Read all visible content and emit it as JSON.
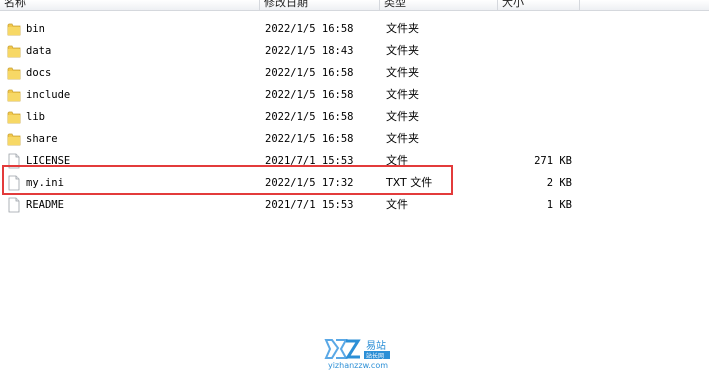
{
  "columns": {
    "name": "名称",
    "date": "修改日期",
    "type": "类型",
    "size": "大小"
  },
  "files": [
    {
      "name": "bin",
      "date": "2022/1/5 16:58",
      "type": "文件夹",
      "size": "",
      "icon": "folder-icon"
    },
    {
      "name": "data",
      "date": "2022/1/5 18:43",
      "type": "文件夹",
      "size": "",
      "icon": "folder-icon"
    },
    {
      "name": "docs",
      "date": "2022/1/5 16:58",
      "type": "文件夹",
      "size": "",
      "icon": "folder-icon"
    },
    {
      "name": "include",
      "date": "2022/1/5 16:58",
      "type": "文件夹",
      "size": "",
      "icon": "folder-icon"
    },
    {
      "name": "lib",
      "date": "2022/1/5 16:58",
      "type": "文件夹",
      "size": "",
      "icon": "folder-icon"
    },
    {
      "name": "share",
      "date": "2022/1/5 16:58",
      "type": "文件夹",
      "size": "",
      "icon": "folder-icon"
    },
    {
      "name": "LICENSE",
      "date": "2021/7/1 15:53",
      "type": "文件",
      "size": "271 KB",
      "icon": "file-icon"
    },
    {
      "name": "my.ini",
      "date": "2022/1/5 17:32",
      "type": "TXT 文件",
      "size": "2 KB",
      "icon": "file-icon"
    },
    {
      "name": "README",
      "date": "2021/7/1 15:53",
      "type": "文件",
      "size": "1 KB",
      "icon": "file-icon"
    }
  ],
  "watermark": {
    "brand": "易站",
    "brand_sub": "站长网",
    "url": "yizhanzzw.com"
  },
  "colors": {
    "highlight": "#e33b3b",
    "folder": "#f2c84b",
    "watermark": "#2c8fd6"
  }
}
